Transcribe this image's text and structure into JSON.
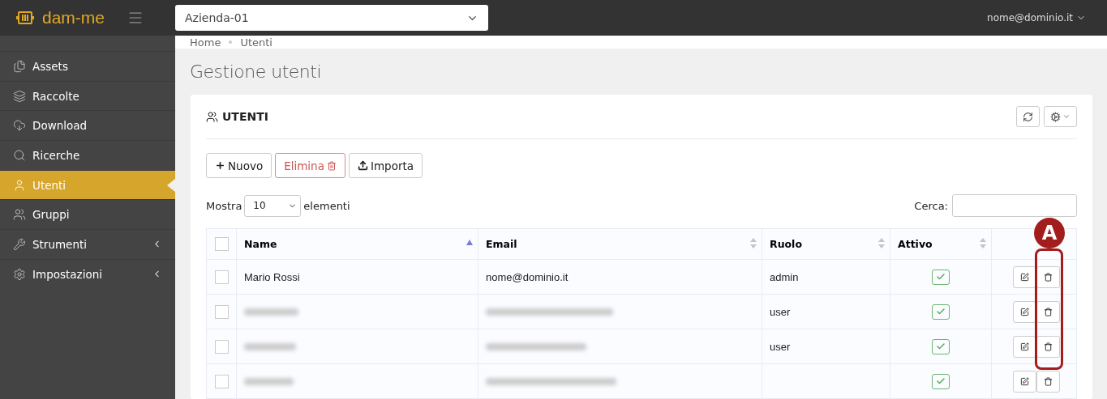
{
  "brand": {
    "name": "dam-me"
  },
  "company_select": {
    "value": "Azienda-01"
  },
  "user_menu": {
    "label": "nome@dominio.it"
  },
  "sidebar": {
    "items": [
      {
        "label": "Assets",
        "selected": false,
        "submenu": false
      },
      {
        "label": "Raccolte",
        "selected": false,
        "submenu": false
      },
      {
        "label": "Download",
        "selected": false,
        "submenu": false
      },
      {
        "label": "Ricerche",
        "selected": false,
        "submenu": false
      },
      {
        "label": "Utenti",
        "selected": true,
        "submenu": false
      },
      {
        "label": "Gruppi",
        "selected": false,
        "submenu": false
      },
      {
        "label": "Strumenti",
        "selected": false,
        "submenu": true
      },
      {
        "label": "Impostazioni",
        "selected": false,
        "submenu": true
      }
    ]
  },
  "breadcrumb": [
    "Home",
    "Utenti"
  ],
  "page_title": "Gestione utenti",
  "card": {
    "title": "UTENTI",
    "actions": [
      {
        "label": "Nuovo",
        "kind": "new"
      },
      {
        "label": "Elimina",
        "kind": "delete"
      },
      {
        "label": "Importa",
        "kind": "import"
      }
    ],
    "length": {
      "prefix": "Mostra",
      "value": "10",
      "suffix": "elementi"
    },
    "search": {
      "label": "Cerca:"
    },
    "table": {
      "select_all": {
        "checked": false
      },
      "columns": [
        {
          "label": "Name",
          "sorted": true
        },
        {
          "label": "Email",
          "sorted": false
        },
        {
          "label": "Ruolo",
          "sorted": false
        },
        {
          "label": "Attivo",
          "sorted": false
        }
      ],
      "rows": [
        {
          "kind": "plain",
          "checked": false,
          "name": "Mario Rossi",
          "email": "nome@dominio.it",
          "role": "admin",
          "active": true
        },
        {
          "kind": "blurred",
          "checked": false,
          "role": "user",
          "active": true
        },
        {
          "kind": "blurred",
          "checked": false,
          "role": "user",
          "active": true
        },
        {
          "kind": "blurred",
          "checked": false,
          "active": true
        }
      ]
    },
    "annotation": {
      "label": "A"
    }
  }
}
